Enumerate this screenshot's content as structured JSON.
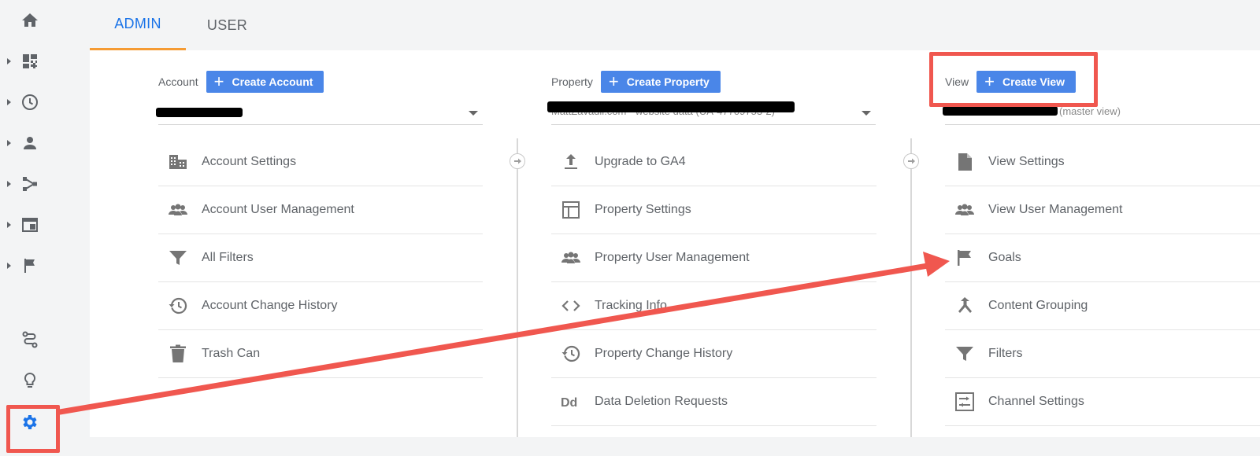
{
  "tabs": {
    "admin_label": "ADMIN",
    "user_label": "USER"
  },
  "account": {
    "label": "Account",
    "create_label": "Create Account",
    "selected_value": "",
    "items": [
      {
        "label": "Account Settings",
        "icon": "building-icon"
      },
      {
        "label": "Account User Management",
        "icon": "people-icon"
      },
      {
        "label": "All Filters",
        "icon": "filter-icon"
      },
      {
        "label": "Account Change History",
        "icon": "history-icon"
      },
      {
        "label": "Trash Can",
        "icon": "trash-icon"
      }
    ]
  },
  "property": {
    "label": "Property",
    "create_label": "Create Property",
    "selected_value": "MattZavadil.com - website data (UA-47709753-2)",
    "items": [
      {
        "label": "Upgrade to GA4",
        "icon": "upload-icon"
      },
      {
        "label": "Property Settings",
        "icon": "layout-icon"
      },
      {
        "label": "Property User Management",
        "icon": "people-icon"
      },
      {
        "label": "Tracking Info",
        "icon": "code-icon"
      },
      {
        "label": "Property Change History",
        "icon": "history-icon"
      },
      {
        "label": "Data Deletion Requests",
        "icon": "dd-icon"
      }
    ]
  },
  "view": {
    "label": "View",
    "create_label": "Create View",
    "selected_suffix": "(master view)",
    "items": [
      {
        "label": "View Settings",
        "icon": "document-icon"
      },
      {
        "label": "View User Management",
        "icon": "people-icon"
      },
      {
        "label": "Goals",
        "icon": "flag-icon"
      },
      {
        "label": "Content Grouping",
        "icon": "merge-icon"
      },
      {
        "label": "Filters",
        "icon": "filter-icon"
      },
      {
        "label": "Channel Settings",
        "icon": "channel-settings-icon"
      }
    ]
  },
  "leftnav": {
    "items": [
      "home-icon",
      "customization-icon",
      "realtime-icon",
      "audience-icon",
      "acquisition-icon",
      "behavior-icon",
      "conversions-icon",
      "attribution-icon",
      "discover-icon",
      "admin-gear-icon"
    ]
  },
  "colors": {
    "accent": "#1a73e8",
    "button": "#4a86e8",
    "tab_underline": "#f59b33",
    "annotation": "#f0574f",
    "gear_active": "#1a73e8"
  }
}
